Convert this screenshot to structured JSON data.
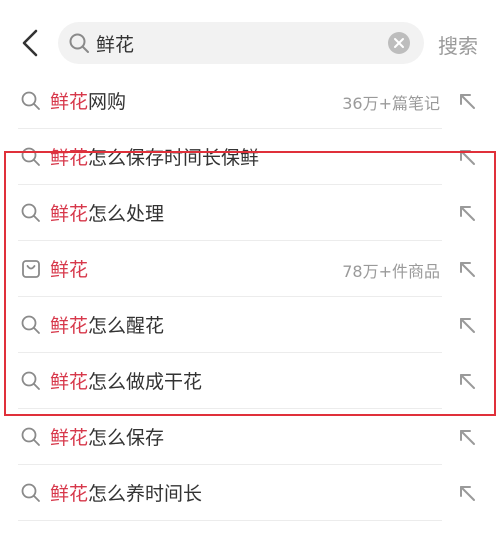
{
  "search": {
    "query": "鲜花",
    "submit_label": "搜索"
  },
  "suggestions": [
    {
      "highlight": "鲜花",
      "rest": "网购",
      "meta": "36万+篇笔记",
      "icon": "search-icon"
    },
    {
      "highlight": "鲜花",
      "rest": "怎么保存时间长保鲜",
      "meta": "",
      "icon": "search-icon"
    },
    {
      "highlight": "鲜花",
      "rest": "怎么处理",
      "meta": "",
      "icon": "search-icon"
    },
    {
      "highlight": "鲜花",
      "rest": "",
      "meta": "78万+件商品",
      "icon": "shopping-bag-icon"
    },
    {
      "highlight": "鲜花",
      "rest": "怎么醒花",
      "meta": "",
      "icon": "search-icon"
    },
    {
      "highlight": "鲜花",
      "rest": "怎么做成干花",
      "meta": "",
      "icon": "search-icon"
    },
    {
      "highlight": "鲜花",
      "rest": "怎么保存",
      "meta": "",
      "icon": "search-icon"
    },
    {
      "highlight": "鲜花",
      "rest": "怎么养时间长",
      "meta": "",
      "icon": "search-icon"
    }
  ],
  "colors": {
    "highlight_text": "#d7384b",
    "annotation_box": "#e0303a"
  }
}
